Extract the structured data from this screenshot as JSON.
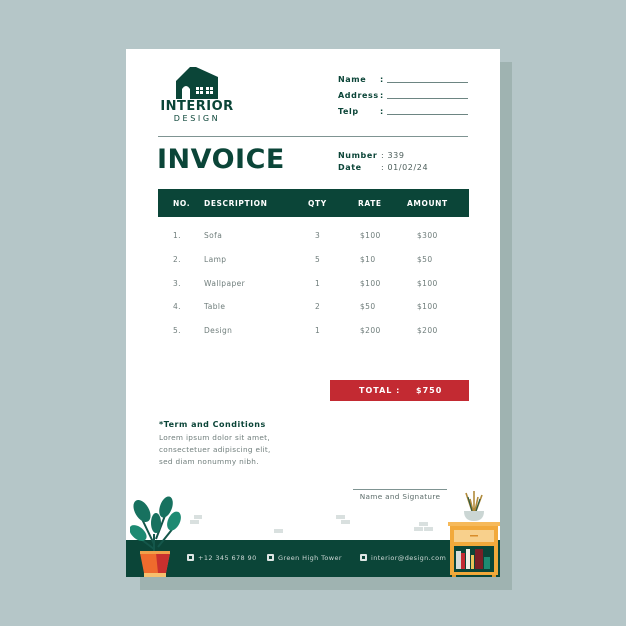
{
  "logo": {
    "title": "INTERIOR",
    "subtitle": "DESIGN",
    "icon": "house-icon"
  },
  "client_info": [
    {
      "label": "Name",
      "colon": ":",
      "value": ""
    },
    {
      "label": "Address",
      "colon": ":",
      "value": ""
    },
    {
      "label": "Telp",
      "colon": ":",
      "value": ""
    }
  ],
  "invoice": {
    "title": "INVOICE",
    "number_label": "Number",
    "number_value": ": 339",
    "date_label": "Date",
    "date_value": ": 01/02/24"
  },
  "table": {
    "headers": [
      "NO.",
      "DESCRIPTION",
      "QTY",
      "RATE",
      "AMOUNT"
    ],
    "rows": [
      {
        "no": "1.",
        "description": "Sofa",
        "qty": "3",
        "rate": "$100",
        "amount": "$300"
      },
      {
        "no": "2.",
        "description": "Lamp",
        "qty": "5",
        "rate": "$10",
        "amount": "$50"
      },
      {
        "no": "3.",
        "description": "Wallpaper",
        "qty": "1",
        "rate": "$100",
        "amount": "$100"
      },
      {
        "no": "4.",
        "description": "Table",
        "qty": "2",
        "rate": "$50",
        "amount": "$100"
      },
      {
        "no": "5.",
        "description": "Design",
        "qty": "1",
        "rate": "$200",
        "amount": "$200"
      }
    ]
  },
  "total": {
    "label": "TOTAL :",
    "value": "$750"
  },
  "terms": {
    "title": "*Term and Conditions",
    "lines": [
      "Lorem ipsum dolor sit amet,",
      "consectetuer adipiscing elit,",
      "sed diam nonummy nibh."
    ]
  },
  "signature": {
    "label": "Name and Signature"
  },
  "footer": {
    "phone": {
      "icon": "phone-icon",
      "text": "+12 345 678 90"
    },
    "address": {
      "icon": "location-pin-icon",
      "text": "Green High Tower"
    },
    "email": {
      "icon": "mail-icon",
      "text": "interior@design.com"
    }
  },
  "colors": {
    "brand_green": "#0b4538",
    "accent_red": "#c32a32",
    "background": "#b5c6c8",
    "paper": "#ffffff"
  }
}
